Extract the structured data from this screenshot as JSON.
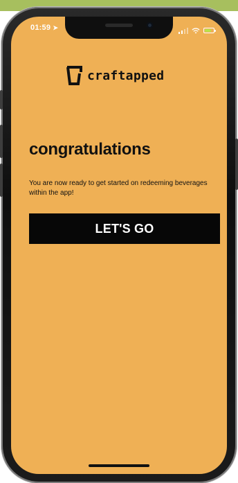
{
  "status_bar": {
    "time": "01:59"
  },
  "brand": {
    "name": "craftapped"
  },
  "content": {
    "title": "congratulations",
    "message": "You are now ready to get started on redeeming beverages within the app!",
    "cta_label": "LET'S GO"
  },
  "theme": {
    "background": "#efb055",
    "primary": "#070707",
    "text": "#111111",
    "banner": "#a7bf5e"
  },
  "icons": {
    "location": "location-arrow-icon",
    "signal": "signal-icon",
    "wifi": "wifi-icon",
    "battery": "battery-icon",
    "logo": "craftapped-logo-icon"
  }
}
